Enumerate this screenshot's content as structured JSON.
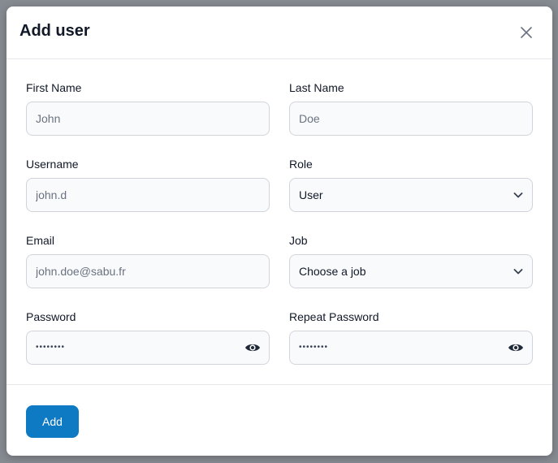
{
  "modal": {
    "title": "Add user",
    "close_icon": "close-icon"
  },
  "form": {
    "first_name": {
      "label": "First Name",
      "placeholder": "John"
    },
    "last_name": {
      "label": "Last Name",
      "placeholder": "Doe"
    },
    "username": {
      "label": "Username",
      "placeholder": "john.d"
    },
    "role": {
      "label": "Role",
      "value": "User",
      "icon": "chevron-down-icon"
    },
    "email": {
      "label": "Email",
      "placeholder": "john.doe@sabu.fr"
    },
    "job": {
      "label": "Job",
      "value": "Choose a job",
      "icon": "chevron-down-icon"
    },
    "password": {
      "label": "Password",
      "value": "••••••••",
      "icon": "eye-icon"
    },
    "repeat_password": {
      "label": "Repeat Password",
      "value": "••••••••",
      "icon": "eye-icon"
    }
  },
  "footer": {
    "add_label": "Add"
  },
  "colors": {
    "primary": "#0e7ac4",
    "input_bg": "#f9fafb",
    "input_border": "#d1d5db",
    "backdrop": "#868a91"
  }
}
